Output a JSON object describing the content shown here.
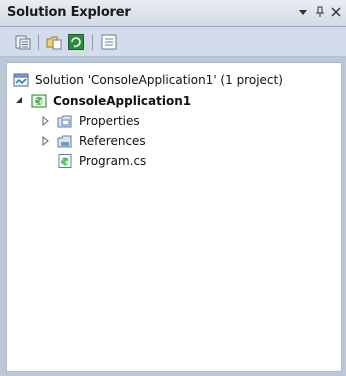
{
  "window": {
    "title": "Solution Explorer",
    "controls": [
      "pin",
      "close"
    ]
  },
  "toolbar": {
    "buttons": [
      "properties-icon",
      "show-all-files-icon",
      "refresh-icon",
      "view-code-icon"
    ]
  },
  "tree": {
    "solution": "Solution 'ConsoleApplication1' (1 project)",
    "project": "ConsoleApplication1",
    "items": [
      {
        "label": "Properties",
        "icon": "properties-folder-icon",
        "expandable": true
      },
      {
        "label": "References",
        "icon": "references-folder-icon",
        "expandable": true
      },
      {
        "label": "Program.cs",
        "icon": "csharp-file-icon",
        "expandable": false
      }
    ]
  },
  "colors": {
    "panel_bg": "#bcc7d8",
    "tree_bg": "#ffffff",
    "accent": "#3a78c2"
  }
}
